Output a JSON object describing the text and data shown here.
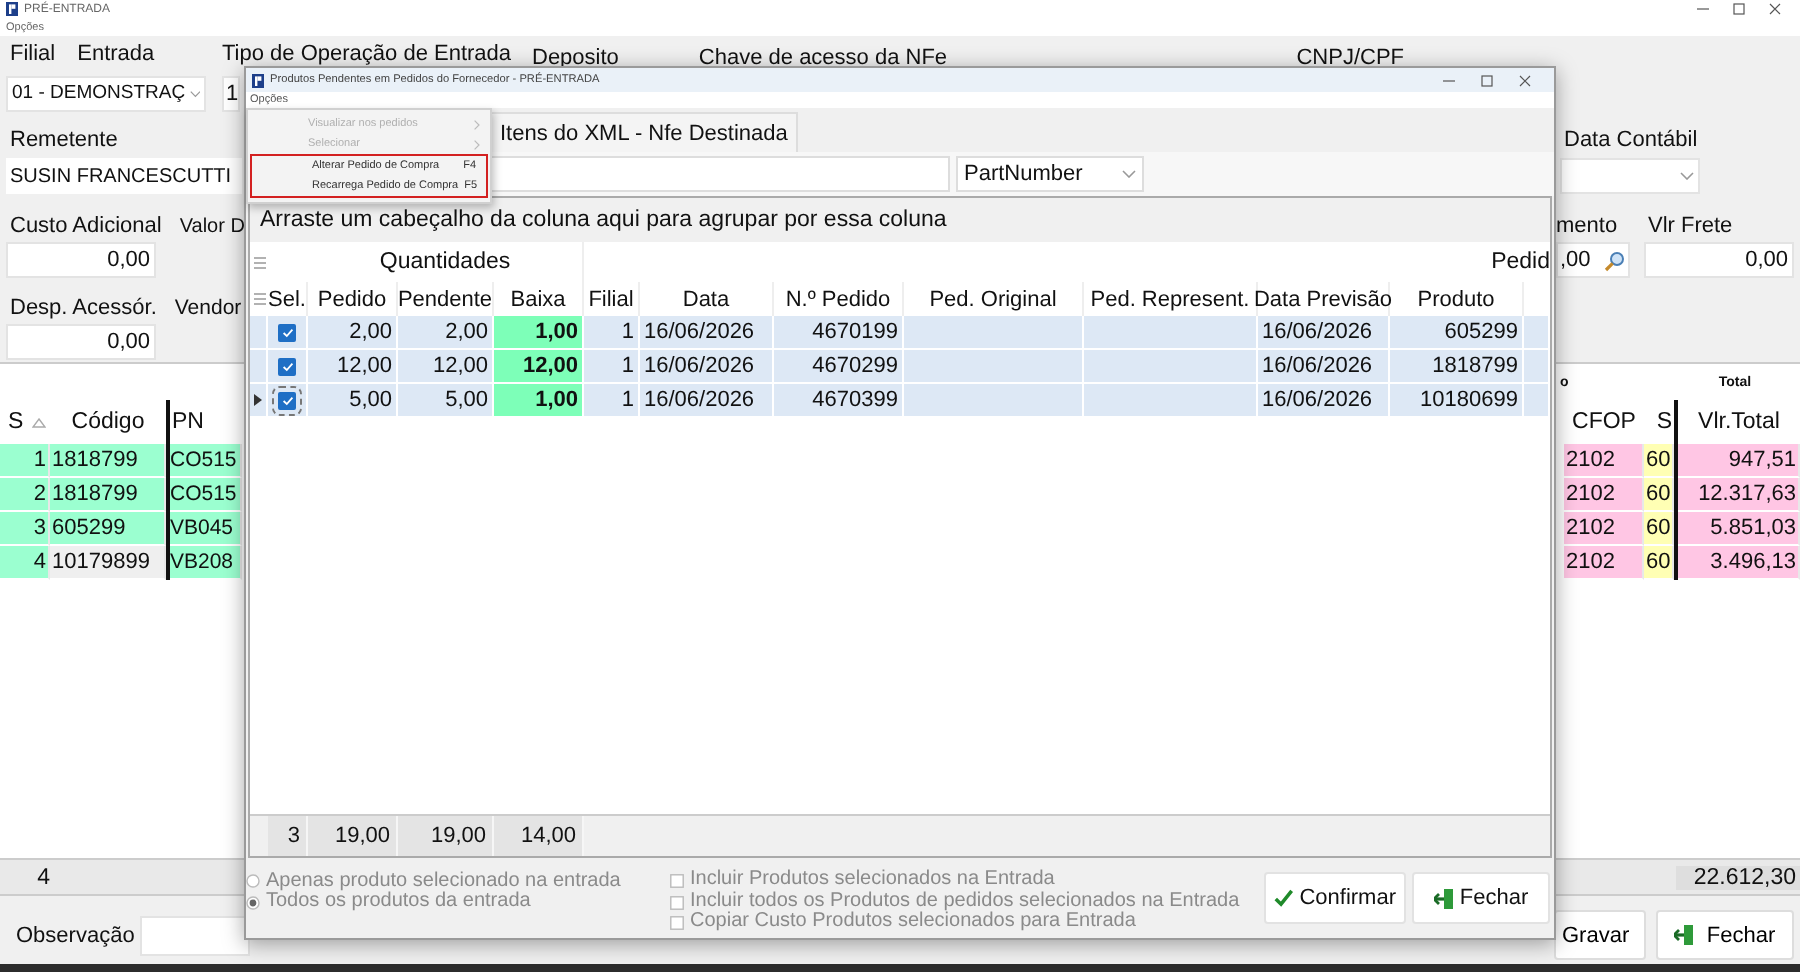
{
  "main_window": {
    "title": "PRÉ-ENTRADA",
    "menu": "Opções",
    "filial": {
      "label": "Filial",
      "sub_label": "Entrada",
      "value": "01 - DEMONSTRAÇ"
    },
    "tipo_operacao": {
      "label": "Tipo de Operação de Entrada",
      "value": "1"
    },
    "deposito": {
      "label": "Deposito"
    },
    "chave_acesso": {
      "label": "Chave de acesso da NFe"
    },
    "cnpj_cpf": {
      "label": "CNPJ/CPF"
    },
    "remetente": {
      "label": "Remetente",
      "value": "SUSIN FRANCESCUTTI"
    },
    "data_contabil": {
      "label": "Data Contábil"
    },
    "custo_adicional": {
      "label": "Custo Adicional",
      "value": "0,00"
    },
    "valor_de": {
      "label": "Valor D"
    },
    "mento": {
      "label": "mento",
      "value": ",00"
    },
    "vlr_frete": {
      "label": "Vlr Frete",
      "value": "0,00"
    },
    "desp_acessor": {
      "label": "Desp. Acessór.",
      "value": "0,00"
    },
    "vendor": {
      "label": "Vendor"
    },
    "items_grid": {
      "bands": [
        "o",
        "Total"
      ],
      "columns": [
        "S",
        "Código",
        "PN",
        "CFOP",
        "S",
        "Vlr.Total"
      ],
      "rows": [
        {
          "s": "1",
          "codigo": "1818799",
          "pn": "CO515",
          "cfop": "2102",
          "st": "60",
          "vlr_total": "947,51",
          "current": false
        },
        {
          "s": "2",
          "codigo": "1818799",
          "pn": "CO515",
          "cfop": "2102",
          "st": "60",
          "vlr_total": "12.317,63",
          "current": false
        },
        {
          "s": "3",
          "codigo": "605299",
          "pn": "VB045",
          "cfop": "2102",
          "st": "60",
          "vlr_total": "5.851,03",
          "current": false
        },
        {
          "s": "4",
          "codigo": "10179899",
          "pn": "VB208",
          "cfop": "2102",
          "st": "60",
          "vlr_total": "3.496,13",
          "current": true
        }
      ],
      "footer": {
        "count": "4",
        "total": "22.612,30"
      }
    },
    "observacao": {
      "label": "Observação"
    },
    "buttons": [
      {
        "label": "Gravar"
      },
      {
        "label": "Fechar",
        "kind": "exit"
      }
    ]
  },
  "dialog": {
    "title": "Produtos Pendentes em Pedidos do Fornecedor - PRÉ-ENTRADA",
    "menu": "Opções",
    "open_menu": [
      {
        "label": "Visualizar nos pedidos",
        "disabled": true,
        "submenu": true,
        "highlighted": false
      },
      {
        "label": "Selecionar",
        "disabled": true,
        "submenu": true,
        "highlighted": false
      },
      {
        "label": "Alterar Pedido de Compra",
        "shortcut": "F4",
        "disabled": false,
        "submenu": false,
        "highlighted": true
      },
      {
        "label": "Recarrega Pedido de Compra",
        "shortcut": "F5",
        "disabled": false,
        "submenu": false,
        "highlighted": true
      }
    ],
    "tab": "Itens do XML - Nfe Destinada",
    "search_by": "PartNumber",
    "group_hint": "Arraste um cabeçalho da coluna aqui para agrupar por essa coluna",
    "bands": [
      "Quantidades",
      "Pedid"
    ],
    "columns": [
      "Sel.",
      "Pedido",
      "Pendente",
      "Baixa",
      "Filial",
      "Data",
      "N.º Pedido",
      "Ped. Original",
      "Ped. Represent.",
      "Data Previsão",
      "Produto"
    ],
    "rows": [
      {
        "checked": true,
        "current": false,
        "pedido": "2,00",
        "pendente": "2,00",
        "baixa": "1,00",
        "filial": "1",
        "data": "16/06/2026",
        "n_pedido": "4670199",
        "data_previsao": "16/06/2026",
        "produto": "605299"
      },
      {
        "checked": true,
        "current": false,
        "pedido": "12,00",
        "pendente": "12,00",
        "baixa": "12,00",
        "filial": "1",
        "data": "16/06/2026",
        "n_pedido": "4670299",
        "data_previsao": "16/06/2026",
        "produto": "1818799"
      },
      {
        "checked": true,
        "current": true,
        "pedido": "5,00",
        "pendente": "5,00",
        "baixa": "1,00",
        "filial": "1",
        "data": "16/06/2026",
        "n_pedido": "4670399",
        "data_previsao": "16/06/2026",
        "produto": "10180699"
      }
    ],
    "footer": {
      "count": "3",
      "pedido": "19,00",
      "pendente": "19,00",
      "baixa": "14,00"
    },
    "radios": [
      {
        "label": "Apenas produto selecionado na entrada",
        "selected": false
      },
      {
        "label": "Todos os produtos da entrada",
        "selected": true
      }
    ],
    "checkboxes": [
      {
        "label": "Incluir Produtos selecionados na Entrada",
        "checked": false
      },
      {
        "label": "Incluir todos os Produtos de pedidos selecionados na Entrada",
        "checked": false
      },
      {
        "label": "Copiar Custo Produtos selecionados para Entrada",
        "checked": false
      }
    ],
    "buttons": [
      {
        "label": "Confirmar",
        "kind": "confirm"
      },
      {
        "label": "Fechar",
        "kind": "exit"
      }
    ]
  }
}
